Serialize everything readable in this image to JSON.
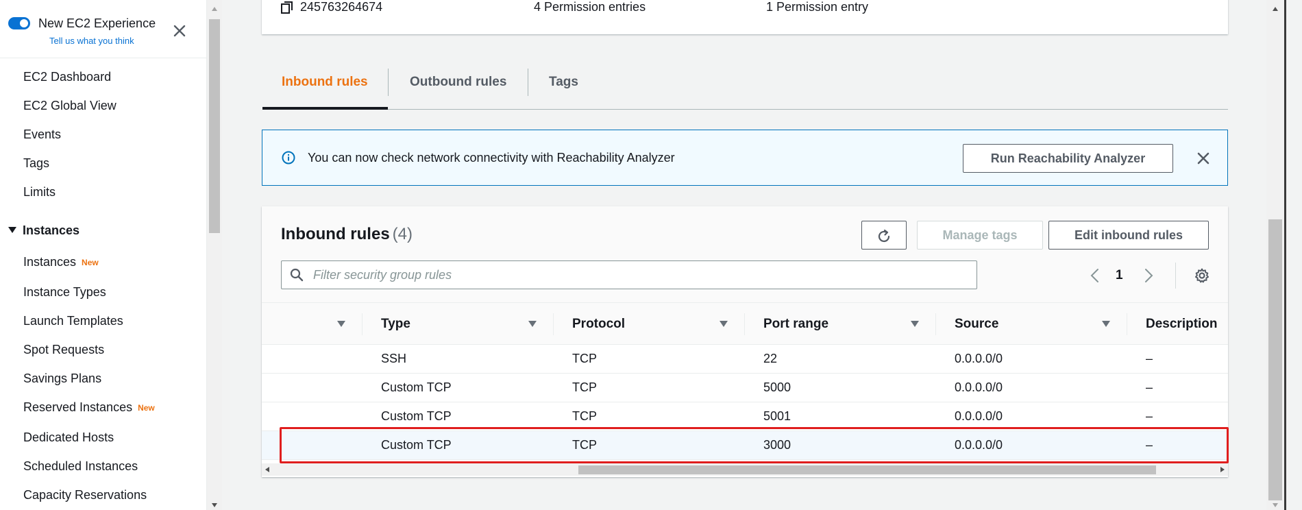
{
  "experience": {
    "title": "New EC2 Experience",
    "link": "Tell us what you think"
  },
  "sidebar": {
    "top_items": [
      {
        "label": "EC2 Dashboard"
      },
      {
        "label": "EC2 Global View"
      },
      {
        "label": "Events"
      },
      {
        "label": "Tags"
      },
      {
        "label": "Limits"
      }
    ],
    "section": "Instances",
    "section_items": [
      {
        "label": "Instances",
        "badge": "New"
      },
      {
        "label": "Instance Types"
      },
      {
        "label": "Launch Templates"
      },
      {
        "label": "Spot Requests"
      },
      {
        "label": "Savings Plans"
      },
      {
        "label": "Reserved Instances",
        "badge": "New"
      },
      {
        "label": "Dedicated Hosts"
      },
      {
        "label": "Scheduled Instances"
      },
      {
        "label": "Capacity Reservations"
      }
    ]
  },
  "top_card": {
    "account_id": "245763264674",
    "permission_entries_1": "4 Permission entries",
    "permission_entries_2": "1 Permission entry"
  },
  "tabs": [
    {
      "label": "Inbound rules",
      "active": true
    },
    {
      "label": "Outbound rules"
    },
    {
      "label": "Tags"
    }
  ],
  "alert": {
    "message": "You can now check network connectivity with Reachability Analyzer",
    "button": "Run Reachability Analyzer"
  },
  "panel": {
    "title": "Inbound rules",
    "count": "(4)",
    "manage_tags": "Manage tags",
    "edit_rules": "Edit inbound rules",
    "filter_placeholder": "Filter security group rules",
    "page": "1"
  },
  "table": {
    "columns": [
      "",
      "Type",
      "Protocol",
      "Port range",
      "Source",
      "Description"
    ],
    "rows": [
      {
        "type": "SSH",
        "protocol": "TCP",
        "port": "22",
        "source": "0.0.0.0/0",
        "description": "–"
      },
      {
        "type": "Custom TCP",
        "protocol": "TCP",
        "port": "5000",
        "source": "0.0.0.0/0",
        "description": "–"
      },
      {
        "type": "Custom TCP",
        "protocol": "TCP",
        "port": "5001",
        "source": "0.0.0.0/0",
        "description": "–"
      },
      {
        "type": "Custom TCP",
        "protocol": "TCP",
        "port": "3000",
        "source": "0.0.0.0/0",
        "description": "–"
      }
    ]
  },
  "colors": {
    "accent_orange": "#ec7211",
    "link_blue": "#0972d3",
    "highlight_red": "#e01e1e"
  }
}
